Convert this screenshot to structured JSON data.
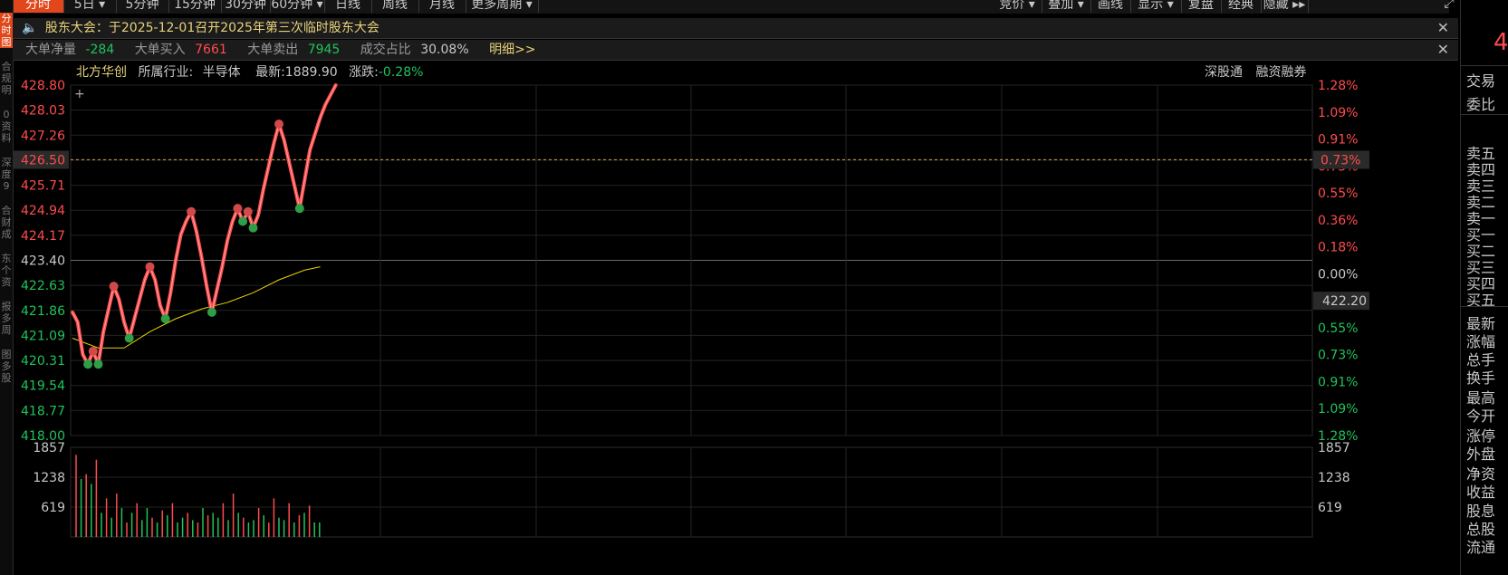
{
  "toolbar": {
    "left_tabs": [
      {
        "label": "分时",
        "active": true
      },
      {
        "label": "5日 ▾",
        "active": false
      },
      {
        "label": "5分钟",
        "active": false
      },
      {
        "label": "15分钟",
        "active": false
      },
      {
        "label": "30分钟",
        "active": false
      },
      {
        "label": "60分钟 ▾",
        "active": false
      },
      {
        "label": "日线",
        "active": false
      },
      {
        "label": "周线",
        "active": false
      },
      {
        "label": "月线",
        "active": false
      },
      {
        "label": "更多周期 ▾",
        "active": false
      }
    ],
    "right_tabs": [
      "竞价 ▾",
      "叠加 ▾",
      "画线",
      "显示 ▾",
      "复盘",
      "经典",
      "隐藏 ▸▸"
    ],
    "expand_icon": "expand-icon"
  },
  "announcement": {
    "text": "股东大会：于2025-12-01召开2025年第三次临时股东大会",
    "icon": "speaker-icon"
  },
  "big_order": {
    "net_label": "大单净量",
    "net_value": "-284",
    "buy_label": "大单买入",
    "buy_value": "7661",
    "sell_label": "大单卖出",
    "sell_value": "7945",
    "ratio_label": "成交占比",
    "ratio_value": "30.08%",
    "detail_link": "明细>>"
  },
  "stock_info": {
    "name": "北方华创",
    "industry_label": "所属行业:",
    "industry": "半导体",
    "latest_label": "最新:",
    "latest": "1889.90",
    "change_label": "涨跌:",
    "change": "-0.28%",
    "tags": [
      "深股通",
      "融资融券"
    ]
  },
  "left_strip": [
    "分",
    "时",
    "图",
    "合",
    "规",
    "明",
    "0",
    "资",
    "料",
    "深",
    "度",
    "9",
    "合",
    "财",
    "成",
    "东",
    "个",
    "资",
    "报",
    "多",
    "周",
    "图",
    "多",
    "股"
  ],
  "right_panel": {
    "top_value": "4",
    "items": [
      "交易",
      "委比",
      "卖五",
      "卖四",
      "卖三",
      "卖二",
      "卖一",
      "买一",
      "买二",
      "买三",
      "买四",
      "买五",
      "最新",
      "涨幅",
      "总手",
      "换手",
      "最高",
      "今开",
      "涨停",
      "外盘",
      "净资",
      "收益",
      "股息",
      "总股",
      "流通"
    ]
  },
  "colors": {
    "up": "#ff4c4c",
    "down": "#1fc35a",
    "price_line": "#ff4f4f",
    "avg_line": "#e8d200",
    "grid": "#2a2a2a",
    "active_tab": "#e2461b"
  },
  "chart_data": {
    "type": "line",
    "price_ticks_left": [
      "428.80",
      "428.03",
      "427.26",
      "426.50",
      "425.71",
      "424.94",
      "424.17",
      "423.40",
      "422.63",
      "421.86",
      "421.09",
      "420.31",
      "419.54",
      "418.77",
      "418.00"
    ],
    "pct_ticks_right": [
      "1.28%",
      "1.09%",
      "0.91%",
      "0.73%",
      "0.55%",
      "0.36%",
      "0.18%",
      "0.00%",
      "0.36%",
      "0.55%",
      "0.73%",
      "0.91%",
      "1.09%",
      "1.28%"
    ],
    "pre_close": 423.4,
    "current_price_marker": "426.50",
    "current_pct_marker": "0.73%",
    "right_marker_low": "422.20",
    "ylim": [
      418.0,
      428.8
    ],
    "price": [
      {
        "t": 0,
        "v": 421.8
      },
      {
        "t": 2,
        "v": 421.5
      },
      {
        "t": 4,
        "v": 420.5
      },
      {
        "t": 6,
        "v": 420.2
      },
      {
        "t": 8,
        "v": 420.6
      },
      {
        "t": 10,
        "v": 420.2
      },
      {
        "t": 12,
        "v": 421.2
      },
      {
        "t": 14,
        "v": 421.9
      },
      {
        "t": 16,
        "v": 422.6
      },
      {
        "t": 18,
        "v": 422.2
      },
      {
        "t": 20,
        "v": 421.5
      },
      {
        "t": 22,
        "v": 421.0
      },
      {
        "t": 24,
        "v": 421.6
      },
      {
        "t": 26,
        "v": 422.2
      },
      {
        "t": 28,
        "v": 422.8
      },
      {
        "t": 30,
        "v": 423.2
      },
      {
        "t": 32,
        "v": 422.8
      },
      {
        "t": 34,
        "v": 422.0
      },
      {
        "t": 36,
        "v": 421.6
      },
      {
        "t": 38,
        "v": 422.4
      },
      {
        "t": 40,
        "v": 423.4
      },
      {
        "t": 42,
        "v": 424.2
      },
      {
        "t": 44,
        "v": 424.6
      },
      {
        "t": 46,
        "v": 424.9
      },
      {
        "t": 48,
        "v": 424.3
      },
      {
        "t": 50,
        "v": 423.5
      },
      {
        "t": 52,
        "v": 422.6
      },
      {
        "t": 54,
        "v": 421.8
      },
      {
        "t": 56,
        "v": 422.5
      },
      {
        "t": 58,
        "v": 423.2
      },
      {
        "t": 60,
        "v": 424.0
      },
      {
        "t": 62,
        "v": 424.6
      },
      {
        "t": 64,
        "v": 425.0
      },
      {
        "t": 66,
        "v": 424.6
      },
      {
        "t": 68,
        "v": 424.9
      },
      {
        "t": 70,
        "v": 424.4
      },
      {
        "t": 72,
        "v": 424.8
      },
      {
        "t": 74,
        "v": 425.6
      },
      {
        "t": 76,
        "v": 426.3
      },
      {
        "t": 78,
        "v": 427.0
      },
      {
        "t": 80,
        "v": 427.6
      },
      {
        "t": 82,
        "v": 427.1
      },
      {
        "t": 84,
        "v": 426.4
      },
      {
        "t": 86,
        "v": 425.7
      },
      {
        "t": 88,
        "v": 425.0
      },
      {
        "t": 90,
        "v": 425.9
      },
      {
        "t": 92,
        "v": 426.8
      },
      {
        "t": 94,
        "v": 427.3
      },
      {
        "t": 96,
        "v": 427.8
      },
      {
        "t": 98,
        "v": 428.2
      },
      {
        "t": 100,
        "v": 428.5
      },
      {
        "t": 102,
        "v": 428.8
      }
    ],
    "avg_price": [
      {
        "t": 0,
        "v": 421.0
      },
      {
        "t": 10,
        "v": 420.7
      },
      {
        "t": 20,
        "v": 420.7
      },
      {
        "t": 30,
        "v": 421.2
      },
      {
        "t": 40,
        "v": 421.6
      },
      {
        "t": 50,
        "v": 421.9
      },
      {
        "t": 60,
        "v": 422.1
      },
      {
        "t": 70,
        "v": 422.4
      },
      {
        "t": 80,
        "v": 422.8
      },
      {
        "t": 90,
        "v": 423.1
      },
      {
        "t": 96,
        "v": 423.2
      }
    ],
    "volume_ticks": [
      "1857",
      "1238",
      "619"
    ],
    "volume_ylim": [
      0,
      1857
    ],
    "volume": [
      1700,
      1200,
      1300,
      1100,
      1600,
      500,
      800,
      400,
      900,
      600,
      300,
      500,
      700,
      350,
      600,
      400,
      300,
      550,
      450,
      700,
      300,
      400,
      500,
      350,
      300,
      600,
      450,
      500,
      400,
      700,
      350,
      900,
      500,
      400,
      300,
      350,
      600,
      450,
      300,
      800,
      400,
      350,
      700,
      300,
      450,
      500,
      650,
      300,
      300
    ],
    "volume_up": [
      true,
      false,
      true,
      false,
      true,
      false,
      true,
      false,
      true,
      false,
      true,
      false,
      true,
      false,
      false,
      true,
      false,
      true,
      false,
      true,
      false,
      false,
      true,
      false,
      true,
      false,
      true,
      false,
      false,
      true,
      false,
      true,
      false,
      true,
      false,
      false,
      true,
      false,
      true,
      true,
      false,
      false,
      true,
      false,
      true,
      false,
      true,
      false,
      false
    ]
  }
}
